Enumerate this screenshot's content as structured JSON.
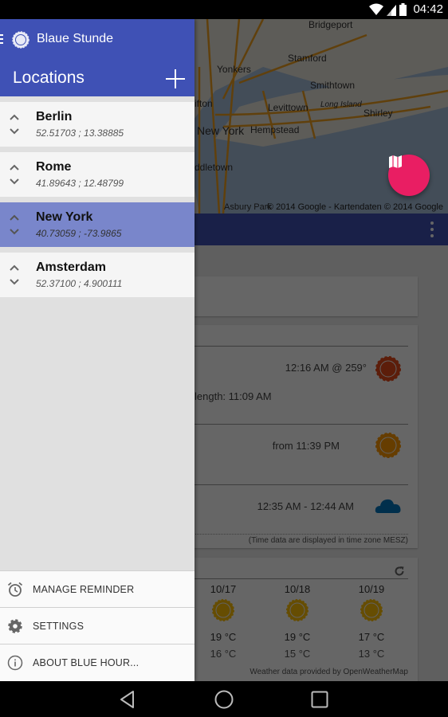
{
  "status_bar": {
    "time": "04:42",
    "icons": [
      "wifi-icon",
      "signal-icon",
      "battery-icon"
    ]
  },
  "drawer": {
    "app_title": "Blaue Stunde",
    "section_title": "Locations",
    "add_button_icon": "plus-icon",
    "locations": [
      {
        "name": "Berlin",
        "coords": "52.51703 ; 13.38885",
        "selected": false
      },
      {
        "name": "Rome",
        "coords": "41.89643 ; 12.48799",
        "selected": false
      },
      {
        "name": "New York",
        "coords": "40.73059 ; -73.9865",
        "selected": true
      },
      {
        "name": "Amsterdam",
        "coords": "52.37100 ; 4.900111",
        "selected": false
      }
    ],
    "footer": [
      {
        "label": "MANAGE REMINDER",
        "icon": "alarm-icon"
      },
      {
        "label": "SETTINGS",
        "icon": "gear-icon"
      },
      {
        "label": "ABOUT BLUE HOUR...",
        "icon": "info-icon"
      }
    ]
  },
  "map": {
    "labels": {
      "bridgeport": "Bridgeport",
      "stamford": "Stamford",
      "yonkers": "Yonkers",
      "smithtown": "Smithtown",
      "clifton": "ifton",
      "levittown": "Levittown",
      "long_island": "Long Island",
      "shirley": "Shirley",
      "new_york": "New York",
      "hempstead": "Hempstead",
      "middletown": "ddletown",
      "asbury_park": "Asbury Park"
    },
    "copyright": "© 2014 Google - Kartendaten © 2014 Google",
    "fab_icon": "map-icon"
  },
  "main": {
    "sun_row": "12:16 AM @ 259°",
    "day_length": "length: 11:09 AM",
    "golden_hour": "from 11:39 PM",
    "blue_hour": "12:35 AM - 12:44 AM",
    "timezone_note": "(Time data are displayed in time zone MESZ)",
    "forecast": [
      {
        "date": "10/17",
        "high": "19 °C",
        "low": "16 °C",
        "icon": "sun-icon"
      },
      {
        "date": "10/18",
        "high": "19 °C",
        "low": "15 °C",
        "icon": "sun-icon"
      },
      {
        "date": "10/19",
        "high": "17 °C",
        "low": "13 °C",
        "icon": "sun-icon"
      }
    ],
    "weather_credit": "Weather data provided by OpenWeatherMap"
  },
  "colors": {
    "primary": "#3f51b5",
    "selected_item": "#7986cb",
    "fab": "#e91e63",
    "sun_red": "#e64a19",
    "sun_orange": "#ff9800",
    "weather_sun": "#ffc107",
    "cloud": "#0277bd"
  }
}
